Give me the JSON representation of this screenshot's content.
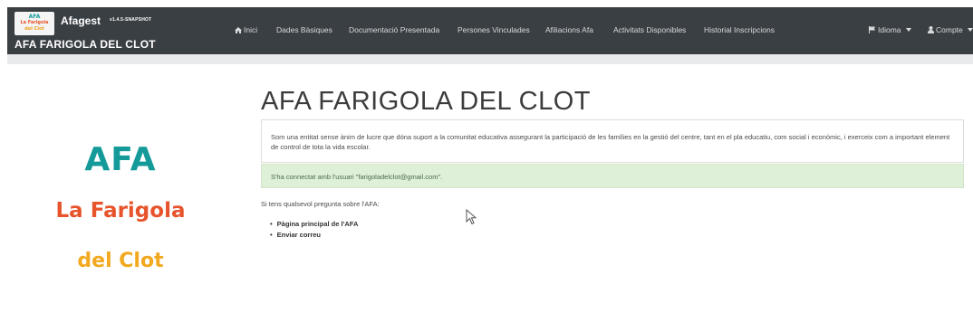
{
  "app": {
    "logo_lines": [
      "AFA",
      "La Farigola",
      "del Clot"
    ],
    "name": "Afagest",
    "version": "v1.4.5-SNAPSHOT",
    "entity_name": "AFA FARIGOLA DEL CLOT"
  },
  "nav": {
    "items": [
      {
        "label": "Inici",
        "icon": "home-icon"
      },
      {
        "label": "Dades Bàsiques"
      },
      {
        "label": "Documentació Presentada"
      },
      {
        "label": "Persones Vinculades"
      },
      {
        "label": "Afiliacions Afa"
      },
      {
        "label": "Activitats Disponibles"
      },
      {
        "label": "Historial Inscripcions"
      }
    ],
    "language": {
      "label": "Idioma",
      "icon": "flag-icon"
    },
    "account": {
      "label": "Compte",
      "icon": "user-icon"
    }
  },
  "logo_text": {
    "line1": "AFA",
    "line2": "La Farigola",
    "line3": "del Clot"
  },
  "main": {
    "title": "AFA FARIGOLA DEL CLOT",
    "intro": "Som una entitat sense ànim de lucre que dóna suport a la comunitat educativa assegurant la participació de les famílies en la gestió del centre, tant en el pla educatiu, com social i econòmic, i exerceix com a important element de control de tota la vida escolar.",
    "alert": "S'ha connectat amb l'usuari \"farigoladelclot@gmail.com\".",
    "question": "Si tens qualsevol pregunta sobre l'AFA:",
    "links": [
      "Pàgina principal de l'AFA",
      "Enviar correu"
    ]
  },
  "colors": {
    "navbar": "#3a3f44",
    "teal": "#139a99",
    "orange": "#e7542c",
    "yellow": "#f2a81f",
    "alert_bg": "#dff0d8"
  }
}
